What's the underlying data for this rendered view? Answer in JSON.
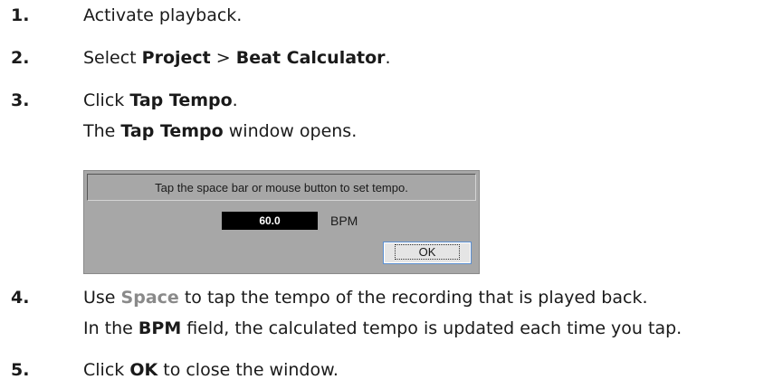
{
  "steps": [
    {
      "num": "1.",
      "text": "Activate playback."
    },
    {
      "num": "2.",
      "pre": "Select ",
      "b1": "Project",
      "mid": " > ",
      "b2": "Beat Calculator",
      "post": "."
    },
    {
      "num": "3.",
      "pre": "Click ",
      "b1": "Tap Tempo",
      "post": ".",
      "sub_pre": "The ",
      "sub_b": "Tap Tempo",
      "sub_post": " window opens."
    },
    {
      "num": "4.",
      "pre": "Use ",
      "key": "Space",
      "post": " to tap the tempo of the recording that is played back.",
      "sub_pre": "In the ",
      "sub_b": "BPM",
      "sub_post": " field, the calculated tempo is updated each time you tap."
    },
    {
      "num": "5.",
      "pre": "Click ",
      "b1": "OK",
      "post": " to close the window."
    }
  ],
  "dialog": {
    "message": "Tap the space bar or mouse button to set tempo.",
    "bpm_value": "60.0",
    "bpm_label": "BPM",
    "ok_label": "OK"
  }
}
